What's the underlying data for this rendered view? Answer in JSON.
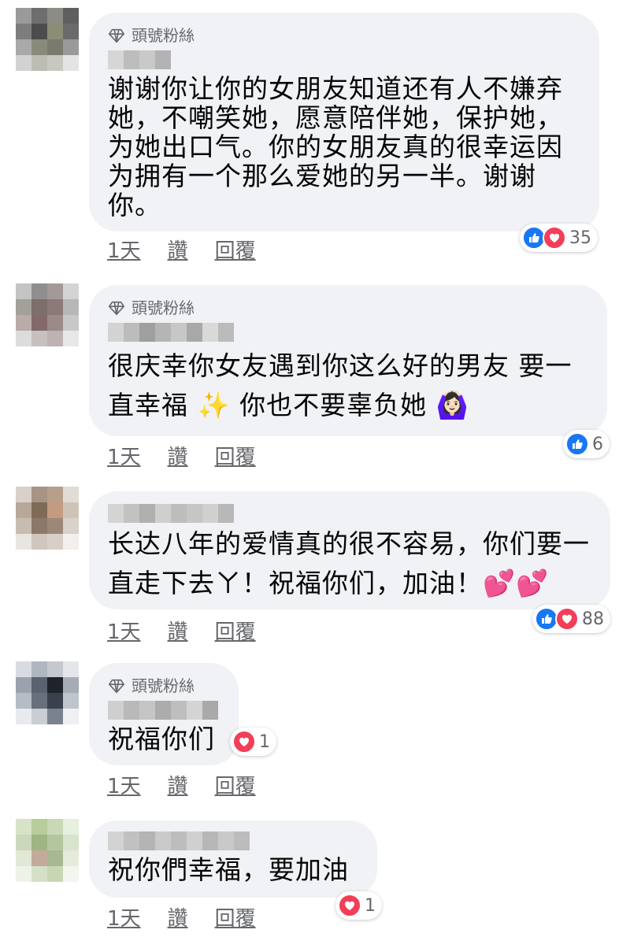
{
  "comments": [
    {
      "badge": "頭號粉絲",
      "text": "谢谢你让你的女朋友知道还有人不嫌弃她，不嘲笑她，愿意陪伴她，保护她，为她出口气。你的女朋友真的很幸运因为拥有一个那么爱她的另一半。谢谢你。",
      "time": "1天",
      "like_label": "讚",
      "reply_label": "回覆",
      "reaction_count": "35",
      "reactions": [
        "like-icon",
        "love-icon"
      ]
    },
    {
      "badge": "頭號粉絲",
      "text": "很庆幸你女友遇到你这么好的男友 要一直幸福 ✨ 你也不要辜负她 🙆🏻‍♀️",
      "time": "1天",
      "like_label": "讚",
      "reply_label": "回覆",
      "reaction_count": "6",
      "reactions": [
        "like-icon"
      ]
    },
    {
      "badge": "",
      "text": "长达八年的爱情真的很不容易，你们要一直走下去ㄚ！祝福你们，加油！💕💕",
      "time": "1天",
      "like_label": "讚",
      "reply_label": "回覆",
      "reaction_count": "88",
      "reactions": [
        "like-icon",
        "love-icon"
      ]
    },
    {
      "badge": "頭號粉絲",
      "text": "祝福你们",
      "time": "1天",
      "like_label": "讚",
      "reply_label": "回覆",
      "reaction_count": "1",
      "reactions": [
        "love-icon"
      ]
    },
    {
      "badge": "",
      "text": "祝你們幸福，要加油",
      "time": "1天",
      "like_label": "讚",
      "reply_label": "回覆",
      "reaction_count": "1",
      "reactions": [
        "love-icon"
      ]
    }
  ],
  "colors": {
    "bubble": "#f0f2f5",
    "like": "#1877f2",
    "love": "#f33e58",
    "meta": "#65676b"
  }
}
